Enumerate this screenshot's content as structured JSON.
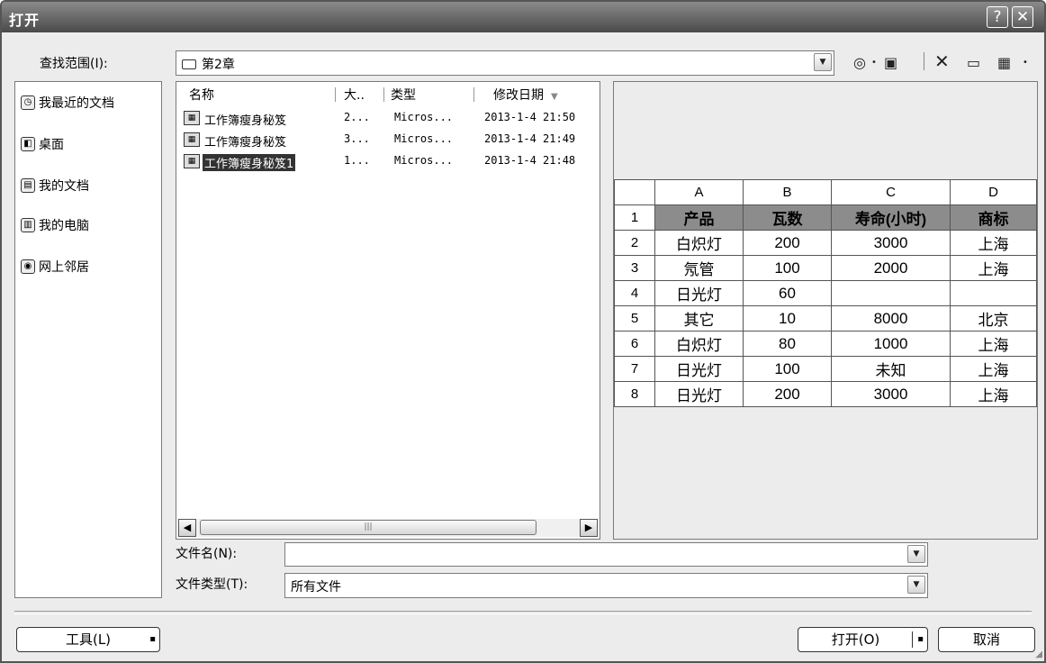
{
  "window": {
    "title": "打开",
    "help_label": "?",
    "close_label": "✕"
  },
  "lookin": {
    "label": "查找范围(I):",
    "value": "第2章"
  },
  "places": [
    {
      "label": "我最近的文档"
    },
    {
      "label": "桌面"
    },
    {
      "label": "我的文档"
    },
    {
      "label": "我的电脑"
    },
    {
      "label": "网上邻居"
    }
  ],
  "file_columns": {
    "name": "名称",
    "size": "大..",
    "type": "类型",
    "modified": "修改日期"
  },
  "files": [
    {
      "name": "工作簿瘦身秘笈",
      "size": "2...",
      "type": "Micros...",
      "modified": "2013-1-4 21:50"
    },
    {
      "name": "工作簿瘦身秘笈",
      "size": "3...",
      "type": "Micros...",
      "modified": "2013-1-4 21:49"
    },
    {
      "name": "工作簿瘦身秘笈1",
      "size": "1...",
      "type": "Micros...",
      "modified": "2013-1-4 21:48"
    }
  ],
  "preview": {
    "columns": [
      "A",
      "B",
      "C",
      "D"
    ],
    "rows": [
      {
        "n": "1",
        "cells": [
          "产品",
          "瓦数",
          "寿命(小时)",
          "商标"
        ]
      },
      {
        "n": "2",
        "cells": [
          "白炽灯",
          "200",
          "3000",
          "上海"
        ]
      },
      {
        "n": "3",
        "cells": [
          "氖管",
          "100",
          "2000",
          "上海"
        ]
      },
      {
        "n": "4",
        "cells": [
          "日光灯",
          "60",
          "",
          ""
        ]
      },
      {
        "n": "5",
        "cells": [
          "其它",
          "10",
          "8000",
          "北京"
        ]
      },
      {
        "n": "6",
        "cells": [
          "白炽灯",
          "80",
          "1000",
          "上海"
        ]
      },
      {
        "n": "7",
        "cells": [
          "日光灯",
          "100",
          "未知",
          "上海"
        ]
      },
      {
        "n": "8",
        "cells": [
          "日光灯",
          "200",
          "3000",
          "上海"
        ]
      }
    ]
  },
  "filename": {
    "label": "文件名(N):",
    "value": ""
  },
  "filetype": {
    "label": "文件类型(T):",
    "value": "所有文件"
  },
  "buttons": {
    "tools": "工具(L)",
    "open": "打开(O)",
    "cancel": "取消"
  }
}
